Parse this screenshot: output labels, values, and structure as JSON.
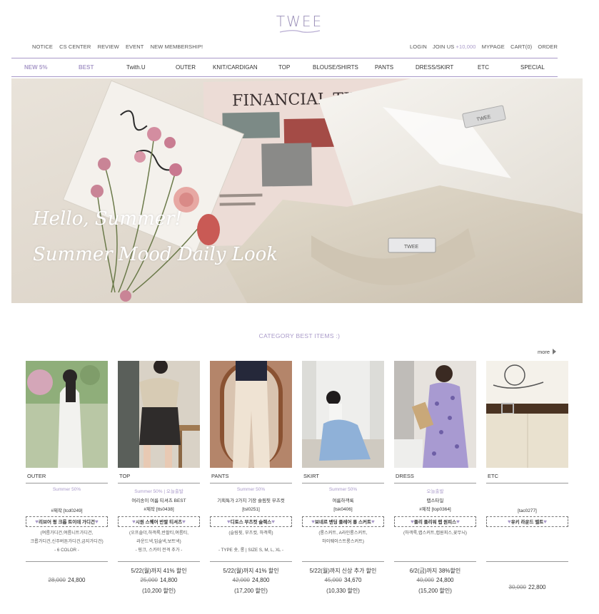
{
  "logo": {
    "text": "TWEE"
  },
  "util_left": [
    "NOTICE",
    "CS CENTER",
    "REVIEW",
    "EVENT",
    "NEW MEMBERSHIP!"
  ],
  "util_right": {
    "login": "LOGIN",
    "join": "JOIN US",
    "join_points": "+10,000",
    "mypage": "MYPAGE",
    "cart": "CART(0)",
    "order": "ORDER"
  },
  "nav": [
    "NEW 5%",
    "BEST",
    "Twith.U",
    "OUTER",
    "KNIT/CARDIGAN",
    "TOP",
    "BLOUSE/SHIRTS",
    "PANTS",
    "DRESS/SKIRT",
    "ETC",
    "SPECIAL"
  ],
  "hero": {
    "line1": "Hello, Summer!",
    "line2": "Summer Mood Daily Look",
    "newspaper": "FINANCIAL TIMES",
    "tag_label": "TWEE"
  },
  "section": {
    "title": "CATEGORY BEST ITEMS :)",
    "more": "more"
  },
  "colors": {
    "accent": "#a99ac9",
    "text": "#333333"
  },
  "products": [
    {
      "category": "OUTER",
      "summer": "Summer 50%",
      "name_lines": [
        "#제작 [tcd0249]"
      ],
      "badge": "리브어 펑 크롭 트이데 가디건",
      "desc_lines": [
        "(여름가디건,여름니트가디건,",
        "크롭가디건,신주버튼가디건,금지가디건)"
      ],
      "option": "- 6 COLOR -",
      "promo": "",
      "old_price": "28,000",
      "price": "24,800",
      "discount": ""
    },
    {
      "category": "TOP",
      "summer": "Summer 50% | 오늘출발",
      "name_lines": [
        "여리송이 여름 티셔츠 BEST",
        "#제작 [tts0438]"
      ],
      "badge": "시원 스퀘어 반팔 티셔츠",
      "desc_lines": [
        "(오프숄더,하객룩,반팔티,여름티,",
        "라운드넥,입술넥,보트넥)"
      ],
      "option": "- 핑크, 스카이 전격 추가 -",
      "promo": "5/22(월)까지 41% 할인",
      "old_price": "25,000",
      "price": "14,800",
      "discount": "(10,200 할인)"
    },
    {
      "category": "PANTS",
      "summer": "Summer 50%",
      "name_lines": [
        "기획특가 2가지 기장 슬림핏 부츠컷",
        "[tsl0251]"
      ],
      "badge": "디토스 부츠컷 슬랙스",
      "desc_lines": [
        "(슬림핏, 부츠컷, 하객룩)"
      ],
      "option": "- TYPE 숏, 롱 | SIZE S, M, L, XL -",
      "promo": "5/22(월)까지 41% 할인",
      "old_price": "42,000",
      "price": "24,800",
      "discount": "(17,200 할인)"
    },
    {
      "category": "SKIRT",
      "summer": "Summer 50%",
      "name_lines": [
        "여름하객룩",
        "[tsk0406]"
      ],
      "badge": "보네르 밴딩 플레어 롱 스커트",
      "desc_lines": [
        "(롱스커트, A라인롱스커트,",
        "하이웨이스트롱스커트)"
      ],
      "option": "",
      "promo": "5/22(월)까지 신상 추가 할인",
      "old_price": "45,000",
      "price": "34,670",
      "discount": "(10,330 할인)"
    },
    {
      "category": "DRESS",
      "summer": "오늘출발",
      "name_lines": [
        "랩스타일",
        "#제작 [top0364]"
      ],
      "badge": "플리 플리워 랩 원피스",
      "desc_lines": [
        "(하객룩,랩스커트,랩원피스,꽃무늬)"
      ],
      "option": "",
      "promo": "6/2(금)까지 38%할인",
      "old_price": "40,000",
      "price": "24,800",
      "discount": "(15,200 할인)"
    },
    {
      "category": "ETC",
      "summer": "",
      "name_lines": [
        "[tac0277]"
      ],
      "badge": "유키 라운드 벨트",
      "desc_lines": [],
      "option": "",
      "promo": "",
      "old_price": "30,000",
      "price": "22,800",
      "discount": ""
    }
  ]
}
